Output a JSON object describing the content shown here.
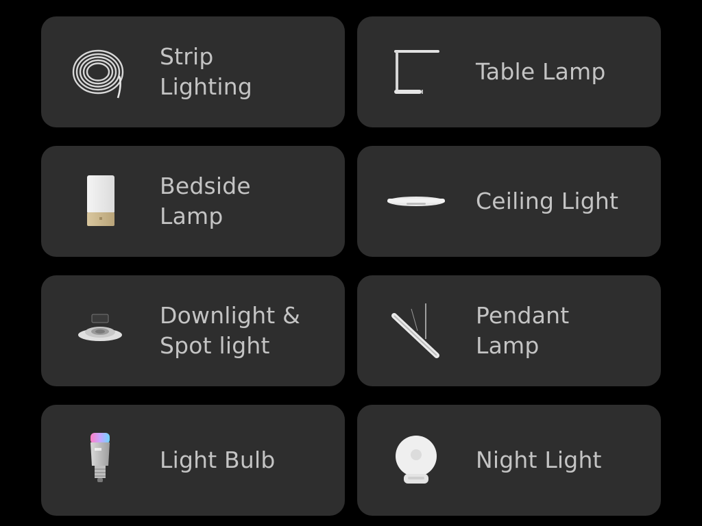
{
  "categories": [
    {
      "label": "Strip\nLighting",
      "icon": "strip-lighting-icon"
    },
    {
      "label": "Table Lamp",
      "icon": "table-lamp-icon"
    },
    {
      "label": "Bedside\nLamp",
      "icon": "bedside-lamp-icon"
    },
    {
      "label": "Ceiling Light",
      "icon": "ceiling-light-icon"
    },
    {
      "label": "Downlight &\nSpot light",
      "icon": "downlight-icon"
    },
    {
      "label": "Pendant\nLamp",
      "icon": "pendant-lamp-icon"
    },
    {
      "label": "Light Bulb",
      "icon": "light-bulb-icon"
    },
    {
      "label": "Night Light",
      "icon": "night-light-icon"
    }
  ],
  "colors": {
    "background": "#000000",
    "card": "#2e2e2e",
    "text": "#c4c4c4"
  }
}
